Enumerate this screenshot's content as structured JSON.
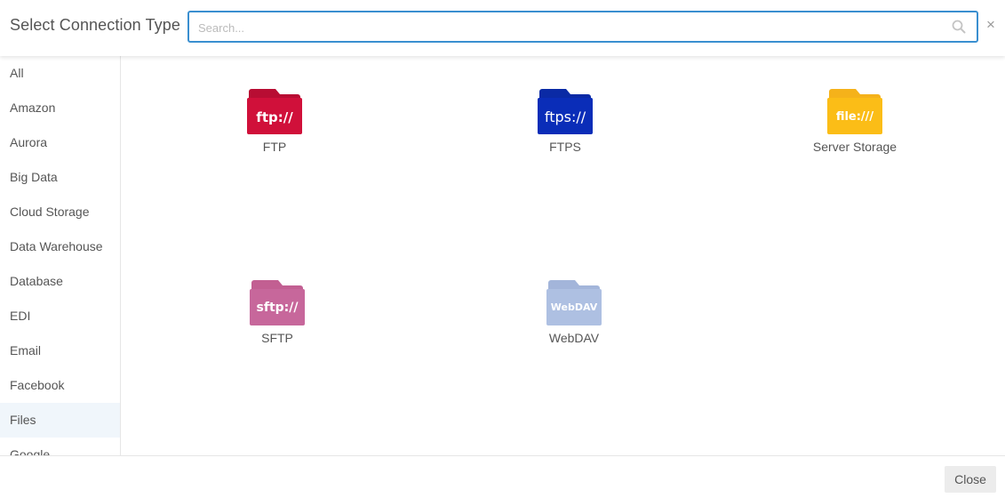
{
  "header": {
    "title": "Select Connection Type",
    "search_placeholder": "Search...",
    "search_value": ""
  },
  "sidebar": {
    "items": [
      {
        "label": "All"
      },
      {
        "label": "Amazon"
      },
      {
        "label": "Aurora"
      },
      {
        "label": "Big Data"
      },
      {
        "label": "Cloud Storage"
      },
      {
        "label": "Data Warehouse"
      },
      {
        "label": "Database"
      },
      {
        "label": "EDI"
      },
      {
        "label": "Email"
      },
      {
        "label": "Facebook"
      },
      {
        "label": "Files"
      },
      {
        "label": "Google"
      }
    ],
    "selected": "Files"
  },
  "connections": [
    {
      "label": "FTP",
      "icon": "ftp-folder-icon",
      "icon_text": "ftp://",
      "color": "#d0103a",
      "tab_color": "#b80d33"
    },
    {
      "label": "FTPS",
      "icon": "ftps-folder-icon",
      "icon_text": "ftps://",
      "color": "#0a2db8",
      "tab_color": "#0a2aa5"
    },
    {
      "label": "Server Storage",
      "icon": "file-folder-icon",
      "icon_text": "file:///",
      "color": "#fbbd17",
      "tab_color": "#f5b21a"
    },
    {
      "label": "SFTP",
      "icon": "sftp-folder-icon",
      "icon_text": "sftp://",
      "color": "#c7679b",
      "tab_color": "#c25f92"
    },
    {
      "label": "WebDAV",
      "icon": "webdav-folder-icon",
      "icon_text": "WebDAV",
      "color": "#aec0e2",
      "tab_color": "#a3b5da"
    }
  ],
  "footer": {
    "close_label": "Close"
  }
}
